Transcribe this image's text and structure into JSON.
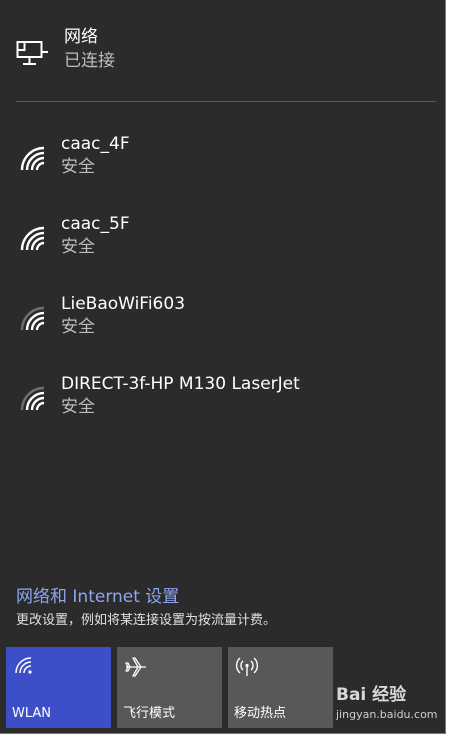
{
  "ethernet": {
    "icon": "ethernet-computer-icon",
    "title": "网络",
    "status": "已连接"
  },
  "networks": [
    {
      "name": "caac_4F",
      "security": "安全",
      "signal": "full",
      "icon": "wifi-signal-icon"
    },
    {
      "name": "caac_5F",
      "security": "安全",
      "signal": "full",
      "icon": "wifi-signal-icon"
    },
    {
      "name": "LieBaoWiFi603",
      "security": "安全",
      "signal": "medium",
      "icon": "wifi-signal-icon"
    },
    {
      "name": "DIRECT-3f-HP M130 LaserJet",
      "security": "安全",
      "signal": "medium",
      "icon": "wifi-signal-icon"
    }
  ],
  "settings": {
    "link": "网络和 Internet 设置",
    "description": "更改设置，例如将某连接设置为按流量计费。"
  },
  "quick_actions": [
    {
      "label": "WLAN",
      "icon": "wifi-icon",
      "active": true
    },
    {
      "label": "飞行模式",
      "icon": "airplane-icon",
      "active": false
    },
    {
      "label": "移动热点",
      "icon": "hotspot-icon",
      "active": false
    }
  ],
  "watermark": {
    "text": "Bai 经验",
    "url": "jingyan.baidu.com"
  },
  "colors": {
    "background": "#2b2b2b",
    "accent": "#3c4fc9",
    "link": "#8fa4f0",
    "tile": "#585858"
  }
}
